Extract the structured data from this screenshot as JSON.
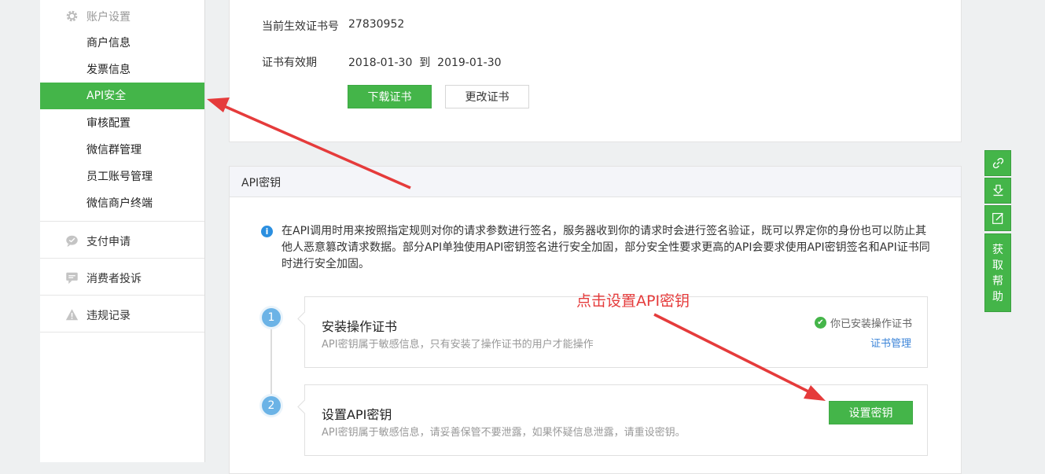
{
  "sidebar": {
    "account_settings": "账户设置",
    "items": [
      {
        "label": "商户信息"
      },
      {
        "label": "发票信息"
      },
      {
        "label": "API安全"
      },
      {
        "label": "审核配置"
      },
      {
        "label": "微信群管理"
      },
      {
        "label": "员工账号管理"
      },
      {
        "label": "微信商户终端"
      }
    ],
    "payment_apply": "支付申请",
    "consumer_complaint": "消费者投诉",
    "violation_record": "违规记录"
  },
  "certificate": {
    "cert_no_label": "当前生效证书号",
    "cert_no": "27830952",
    "validity_label": "证书有效期",
    "validity": "2018-01-30  到  2019-01-30",
    "download_btn": "下载证书",
    "change_btn": "更改证书"
  },
  "api_key": {
    "section_title": "API密钥",
    "notice": "在API调用时用来按照指定规则对你的请求参数进行签名，服务器收到你的请求时会进行签名验证，既可以界定你的身份也可以防止其他人恶意篡改请求数据。部分API单独使用API密钥签名进行安全加固，部分安全性要求更高的API会要求使用API密钥签名和API证书同时进行安全加固。",
    "steps": [
      {
        "num": "1",
        "title": "安装操作证书",
        "desc": "API密钥属于敏感信息，只有安装了操作证书的用户才能操作",
        "status": "你已安装操作证书",
        "link": "证书管理"
      },
      {
        "num": "2",
        "title": "设置API密钥",
        "desc": "API密钥属于敏感信息，请妥善保管不要泄露，如果怀疑信息泄露，请重设密钥。",
        "button": "设置密钥"
      }
    ]
  },
  "annotation": "点击设置API密钥",
  "float_bar": {
    "help": "获取帮助",
    "help_chars": [
      "获",
      "取",
      "帮",
      "助"
    ]
  },
  "colors": {
    "accent": "#44b549",
    "annotation": "#e53b3b",
    "link": "#3b84d8",
    "step": "#6bb3e6"
  },
  "icons": [
    "gear-icon",
    "chat-icon",
    "message-icon",
    "warning-icon",
    "info-icon",
    "check-icon",
    "link-icon",
    "download-icon",
    "edit-icon"
  ]
}
